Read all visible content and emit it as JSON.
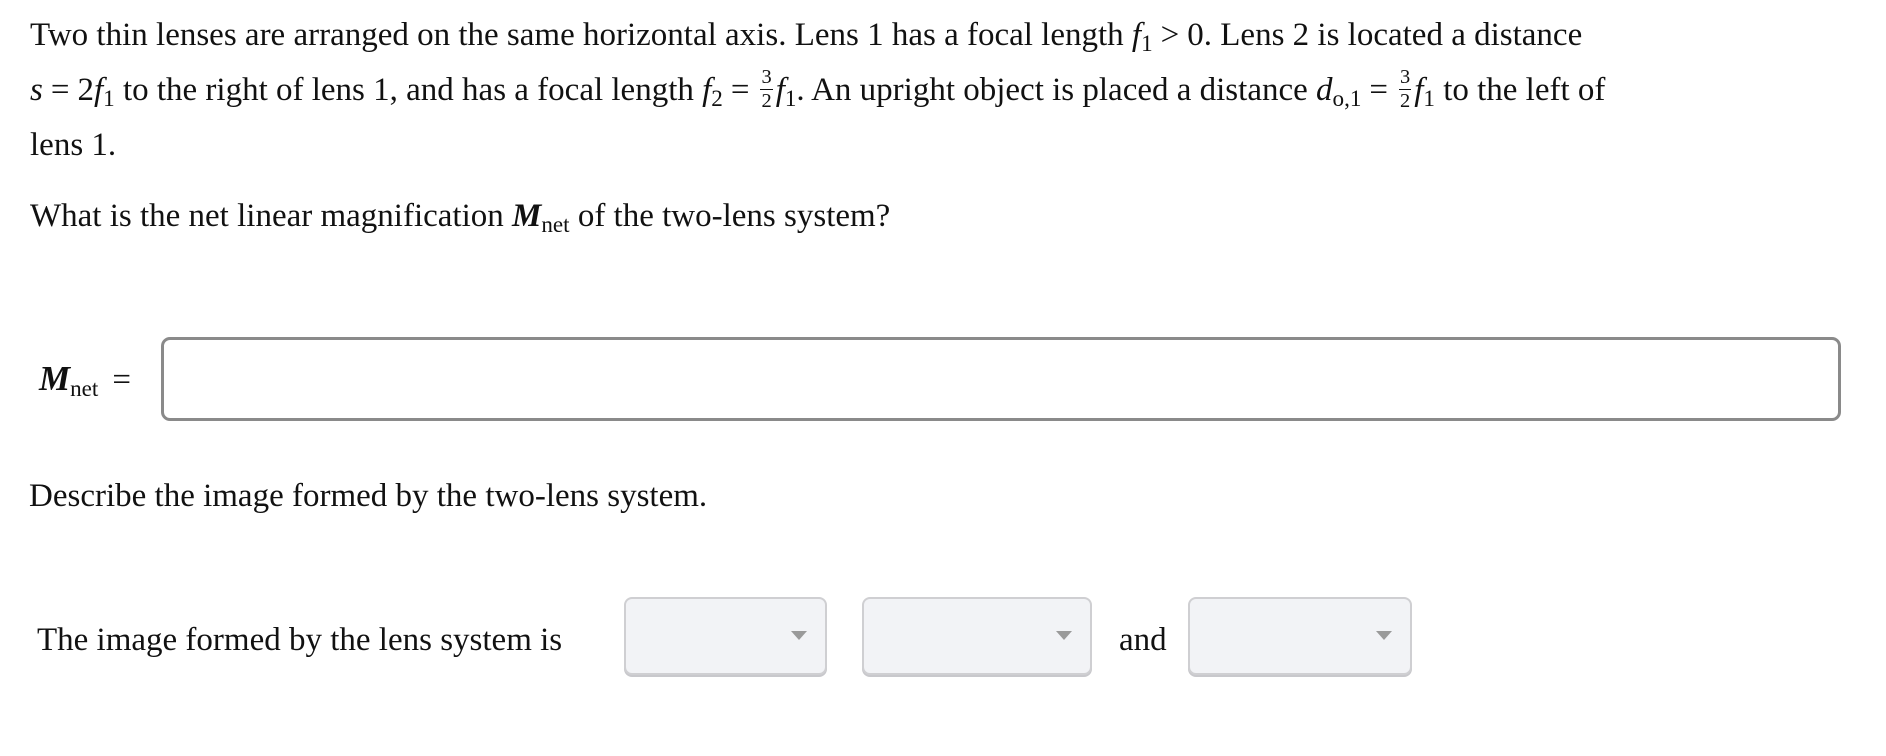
{
  "problem": {
    "line1": {
      "text_a": "Two thin lenses are arranged on the same horizontal axis. Lens 1 has a focal length",
      "var_f": "f",
      "sub_1": "1",
      "rel_gt": ">",
      "text_b": "0. Lens 2 is located a distance"
    },
    "line2": {
      "var_s": "s",
      "eq": "=",
      "coef": "2",
      "var_f": "f",
      "sub_1": "1",
      "text_a": "to the right of lens 1, and has a focal length",
      "sub_2": "2",
      "frac_num": "3",
      "frac_den": "2",
      "text_b": ". An upright object is placed a distance",
      "var_d": "d",
      "sub_o1": "o,1",
      "text_c": "to the left of"
    },
    "line3": {
      "text": "lens 1."
    }
  },
  "question": {
    "text_a": "What is the net linear magnification",
    "var_M": "M",
    "sub_net": "net",
    "text_b": "of the two-lens system?"
  },
  "answer": {
    "label_var": "M",
    "label_sub": "net",
    "label_eq": "=",
    "input_value": "",
    "input_placeholder": ""
  },
  "describe": {
    "prompt": "Describe the image formed by the two-lens system.",
    "sentence_start": "The image formed by the lens system is",
    "conjunction": "and",
    "dropdowns": [
      {
        "selected": ""
      },
      {
        "selected": ""
      },
      {
        "selected": ""
      }
    ]
  },
  "colors": {
    "input_border": "#8a8a8a",
    "dropdown_bg": "#f2f3f6",
    "dropdown_border": "#cfcfd2",
    "caret": "#9a9a9a",
    "text": "#111111"
  }
}
